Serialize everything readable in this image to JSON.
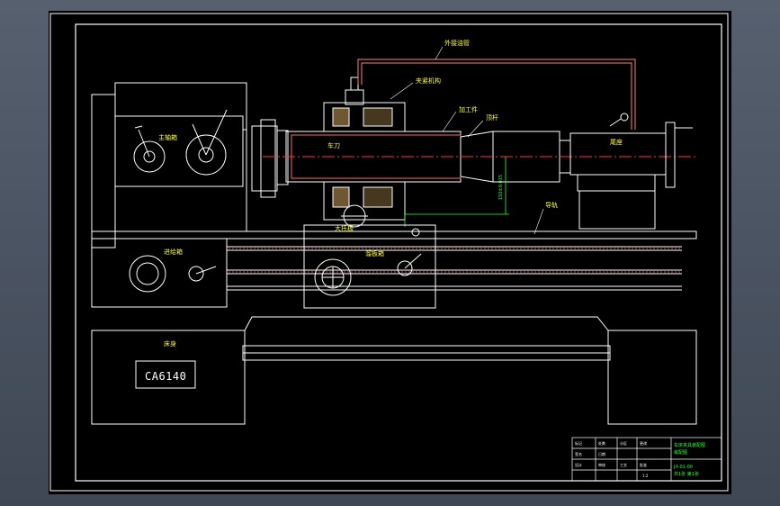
{
  "drawing": {
    "model_label": "CA6140",
    "labels": {
      "coolant_tube": "外接油管",
      "headstock": "主轴箱",
      "fixture_body": "夹紧机构",
      "workpiece": "加工件",
      "rod": "顶杆",
      "tailstock": "尾座",
      "cutter": "车刀",
      "carriage": "大托板",
      "guide_rail": "导轨",
      "feed_box": "进给箱",
      "apron": "溜板箱",
      "bed": "床身"
    },
    "dimension_text": "150±0.015"
  },
  "title_block": {
    "title": "车床夹具装配图",
    "subtitle": "装配图",
    "code": "JX-01-00",
    "sheet_info": "共1张 第1张",
    "scale": "1:2",
    "cells": [
      "标记",
      "处数",
      "分区",
      "更改",
      "签名",
      "日期",
      "设计",
      "审核",
      "工艺",
      "批准"
    ]
  },
  "colors": {
    "frame": "#ffffff",
    "centerline": "#ff3333",
    "dimension": "#33ff33",
    "label": "#ffff33",
    "tube": "#ff6666"
  }
}
